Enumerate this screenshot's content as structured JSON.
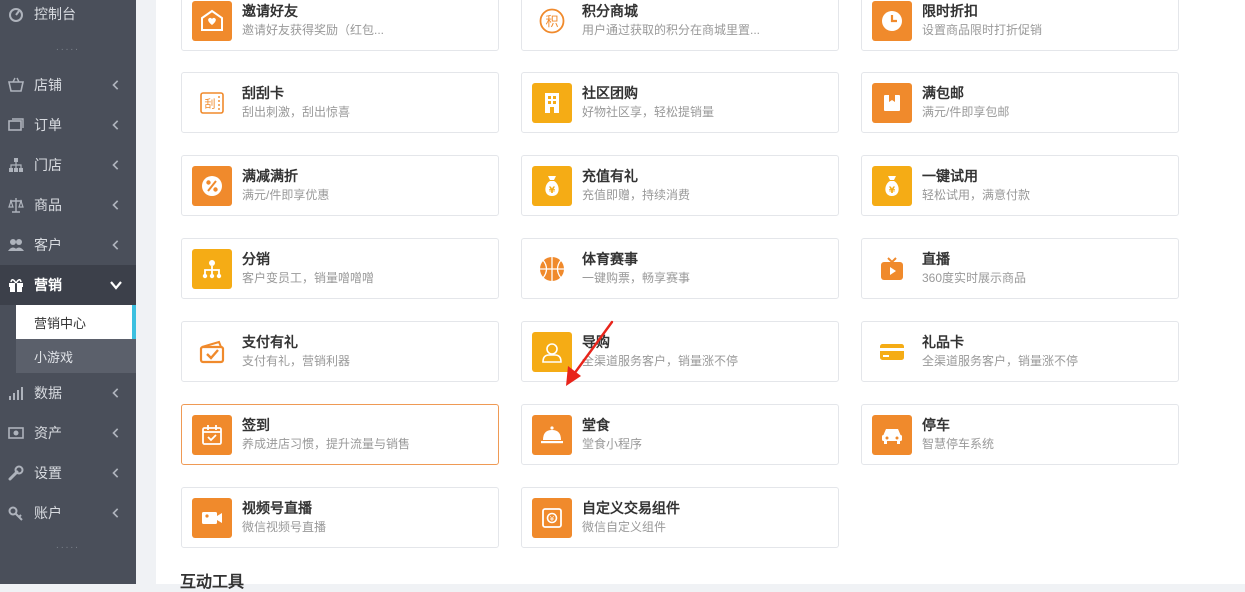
{
  "sidebar": {
    "items": [
      {
        "label": "控制台",
        "icon": "dashboard-icon"
      },
      {
        "label": "店铺",
        "icon": "store-icon"
      },
      {
        "label": "订单",
        "icon": "order-icon"
      },
      {
        "label": "门店",
        "icon": "branch-icon"
      },
      {
        "label": "商品",
        "icon": "scale-icon"
      },
      {
        "label": "客户",
        "icon": "users-icon"
      },
      {
        "label": "营销",
        "icon": "gift-icon"
      },
      {
        "label": "数据",
        "icon": "bar-chart-icon"
      },
      {
        "label": "资产",
        "icon": "money-icon"
      },
      {
        "label": "设置",
        "icon": "wrench-icon"
      },
      {
        "label": "账户",
        "icon": "key-icon"
      }
    ],
    "sub_items": [
      {
        "label": "营销中心"
      },
      {
        "label": "小游戏"
      }
    ],
    "dots": "....."
  },
  "cards": [
    {
      "title": "邀请好友",
      "desc": "邀请好友获得奖励（红包...",
      "icon": "heart-envelope-icon"
    },
    {
      "title": "积分商城",
      "desc": "用户通过获取的积分在商城里置...",
      "icon": "points-icon"
    },
    {
      "title": "限时折扣",
      "desc": "设置商品限时打折促销",
      "icon": "clock-icon"
    },
    {
      "title": "刮刮卡",
      "desc": "刮出刺激，刮出惊喜",
      "icon": "scratch-card-icon"
    },
    {
      "title": "社区团购",
      "desc": "好物社区享，轻松提销量",
      "icon": "building-icon"
    },
    {
      "title": "满包邮",
      "desc": "满元/件即享包邮",
      "icon": "package-icon"
    },
    {
      "title": "满减满折",
      "desc": "满元/件即享优惠",
      "icon": "percent-icon"
    },
    {
      "title": "充值有礼",
      "desc": "充值即赠，持续消费",
      "icon": "money-bag-icon"
    },
    {
      "title": "一键试用",
      "desc": "轻松试用，满意付款",
      "icon": "money-bag-icon"
    },
    {
      "title": "分销",
      "desc": "客户变员工，销量噌噌噌",
      "icon": "distribution-icon"
    },
    {
      "title": "体育赛事",
      "desc": "一键购票，畅享赛事",
      "icon": "basketball-icon"
    },
    {
      "title": "直播",
      "desc": "360度实时展示商品",
      "icon": "tv-icon"
    },
    {
      "title": "支付有礼",
      "desc": "支付有礼，营销利器",
      "icon": "wallet-check-icon"
    },
    {
      "title": "导购",
      "desc": "全渠道服务客户，销量涨不停",
      "icon": "person-icon"
    },
    {
      "title": "礼品卡",
      "desc": "全渠道服务客户，销量涨不停",
      "icon": "gift-card-icon"
    },
    {
      "title": "签到",
      "desc": "养成进店习惯，提升流量与销售",
      "icon": "calendar-check-icon"
    },
    {
      "title": "堂食",
      "desc": "堂食小程序",
      "icon": "cloche-icon"
    },
    {
      "title": "停车",
      "desc": "智慧停车系统",
      "icon": "car-icon"
    },
    {
      "title": "视频号直播",
      "desc": "微信视频号直播",
      "icon": "video-camera-icon"
    },
    {
      "title": "自定义交易组件",
      "desc": "微信自定义组件",
      "icon": "safe-icon"
    }
  ],
  "section_title": "互动工具",
  "colors": {
    "orange": "#f08a2c",
    "amber": "#f5ac15",
    "sidebar_bg": "#4a4f5a",
    "accent": "#3cc0e0"
  }
}
